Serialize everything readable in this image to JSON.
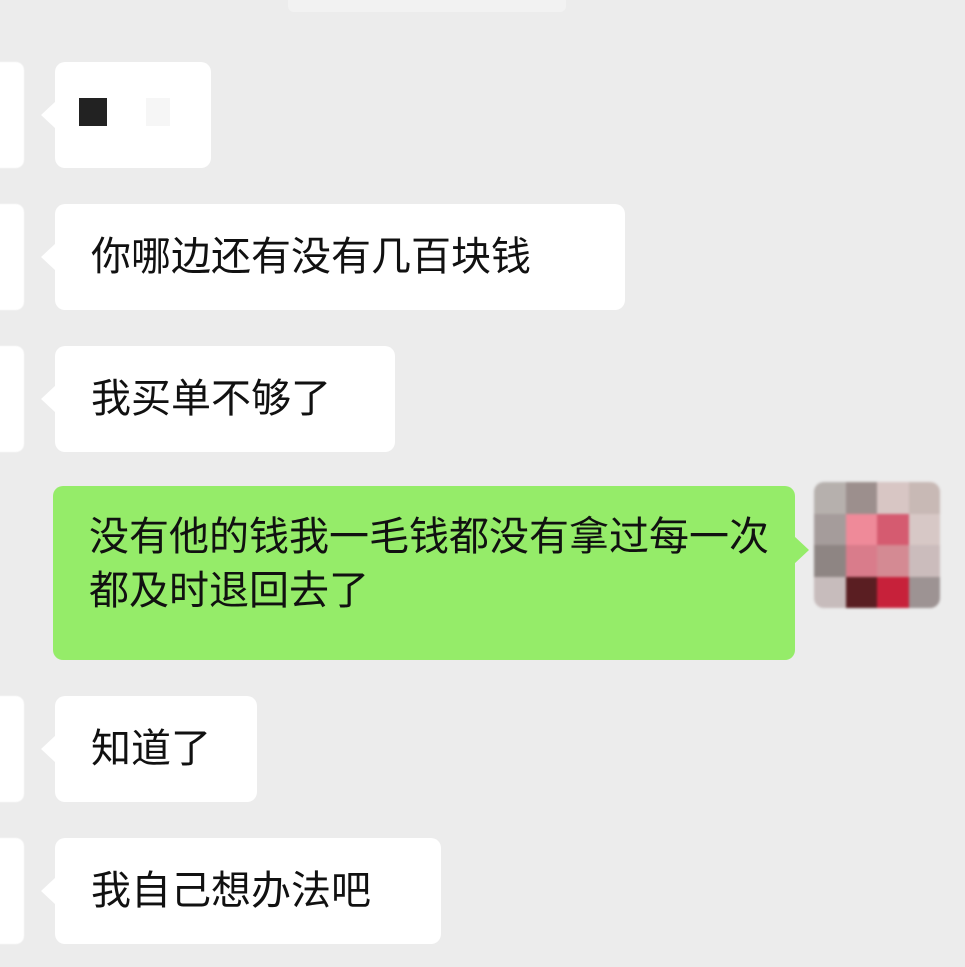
{
  "conversation": {
    "messages": [
      {
        "id": "m1",
        "direction": "incoming",
        "text": ""
      },
      {
        "id": "m2",
        "direction": "incoming",
        "text": "你哪边还有没有几百块钱"
      },
      {
        "id": "m3",
        "direction": "incoming",
        "text": "我买单不够了"
      },
      {
        "id": "m4",
        "direction": "outgoing",
        "text": "没有他的钱我一毛钱都没有拿过每一次都及时退回去了"
      },
      {
        "id": "m5",
        "direction": "incoming",
        "text": "知道了"
      },
      {
        "id": "m6",
        "direction": "incoming",
        "text": "我自己想办法吧"
      }
    ]
  },
  "colors": {
    "chat_background": "#ececec",
    "incoming_bubble": "#ffffff",
    "outgoing_bubble": "#95ec69",
    "text": "#111111"
  },
  "avatar_pixels": [
    "#b6b0ad",
    "#9c8f8d",
    "#d8c6c4",
    "#c8b9b5",
    "#a59c9b",
    "#ef8a99",
    "#d55b70",
    "#d7c8c6",
    "#8e8583",
    "#d97c8b",
    "#d48a93",
    "#cbbcbc",
    "#c7bcbc",
    "#5a1e22",
    "#c7213a",
    "#9d9393"
  ]
}
